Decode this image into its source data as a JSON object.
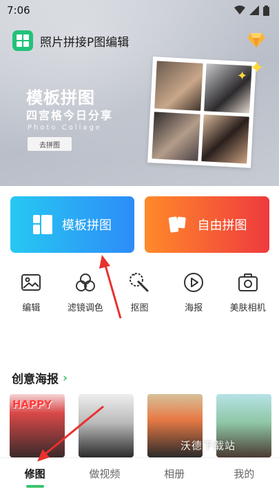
{
  "status": {
    "time": "7:06"
  },
  "app": {
    "title": "照片拼接P图编辑"
  },
  "banner": {
    "title": "模板拼图",
    "subtitle": "四宫格今日分享",
    "subtitle_en": "Photo Collage",
    "button_label": "去拼图"
  },
  "main_buttons": {
    "template_label": "模板拼图",
    "free_label": "自由拼图"
  },
  "tools": [
    {
      "label": "编辑",
      "icon": "image-icon"
    },
    {
      "label": "滤镜调色",
      "icon": "filter-icon"
    },
    {
      "label": "抠图",
      "icon": "cutout-icon"
    },
    {
      "label": "海报",
      "icon": "play-icon"
    },
    {
      "label": "美肤相机",
      "icon": "camera-icon"
    }
  ],
  "section": {
    "title": "创意海报"
  },
  "posters": [
    {
      "label": "HAPPY"
    }
  ],
  "watermark": "沃德下载站",
  "nav": [
    {
      "label": "修图"
    },
    {
      "label": "做视频"
    },
    {
      "label": "相册"
    },
    {
      "label": "我的"
    }
  ],
  "colors": {
    "accent_green": "#3cc46d",
    "template_btn_start": "#27c8f2",
    "template_btn_end": "#2d8cf8",
    "free_btn_start": "#ff8a2a",
    "free_btn_end": "#ef3a3e",
    "annotation_arrow": "#e8312f"
  }
}
